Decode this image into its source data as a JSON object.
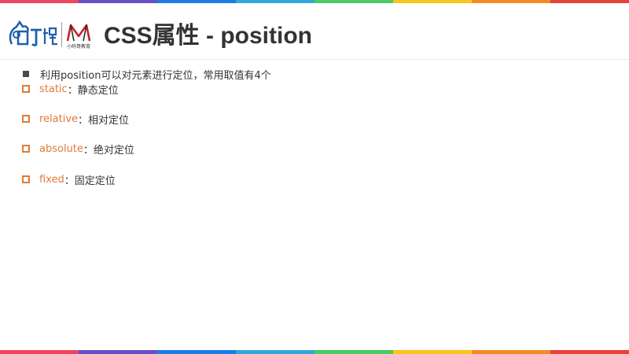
{
  "slide": {
    "title": "CSS属性 - position",
    "logo_secondary_text": "小码哥教育"
  },
  "intro": "利用position可以对元素进行定位，常用取值有4个",
  "items": [
    {
      "keyword": "static",
      "description": "：静态定位"
    },
    {
      "keyword": "relative",
      "description": "：相对定位"
    },
    {
      "keyword": "absolute",
      "description": "：绝对定位"
    },
    {
      "keyword": "fixed",
      "description": "：固定定位"
    }
  ],
  "colors": {
    "keyword": "#e07b39",
    "title": "#333333",
    "stripe": [
      "#f0455e",
      "#6a4fc4",
      "#1e7be6",
      "#2fa8d8",
      "#4cca64",
      "#f7c51c",
      "#f58a22",
      "#e8423c"
    ]
  }
}
